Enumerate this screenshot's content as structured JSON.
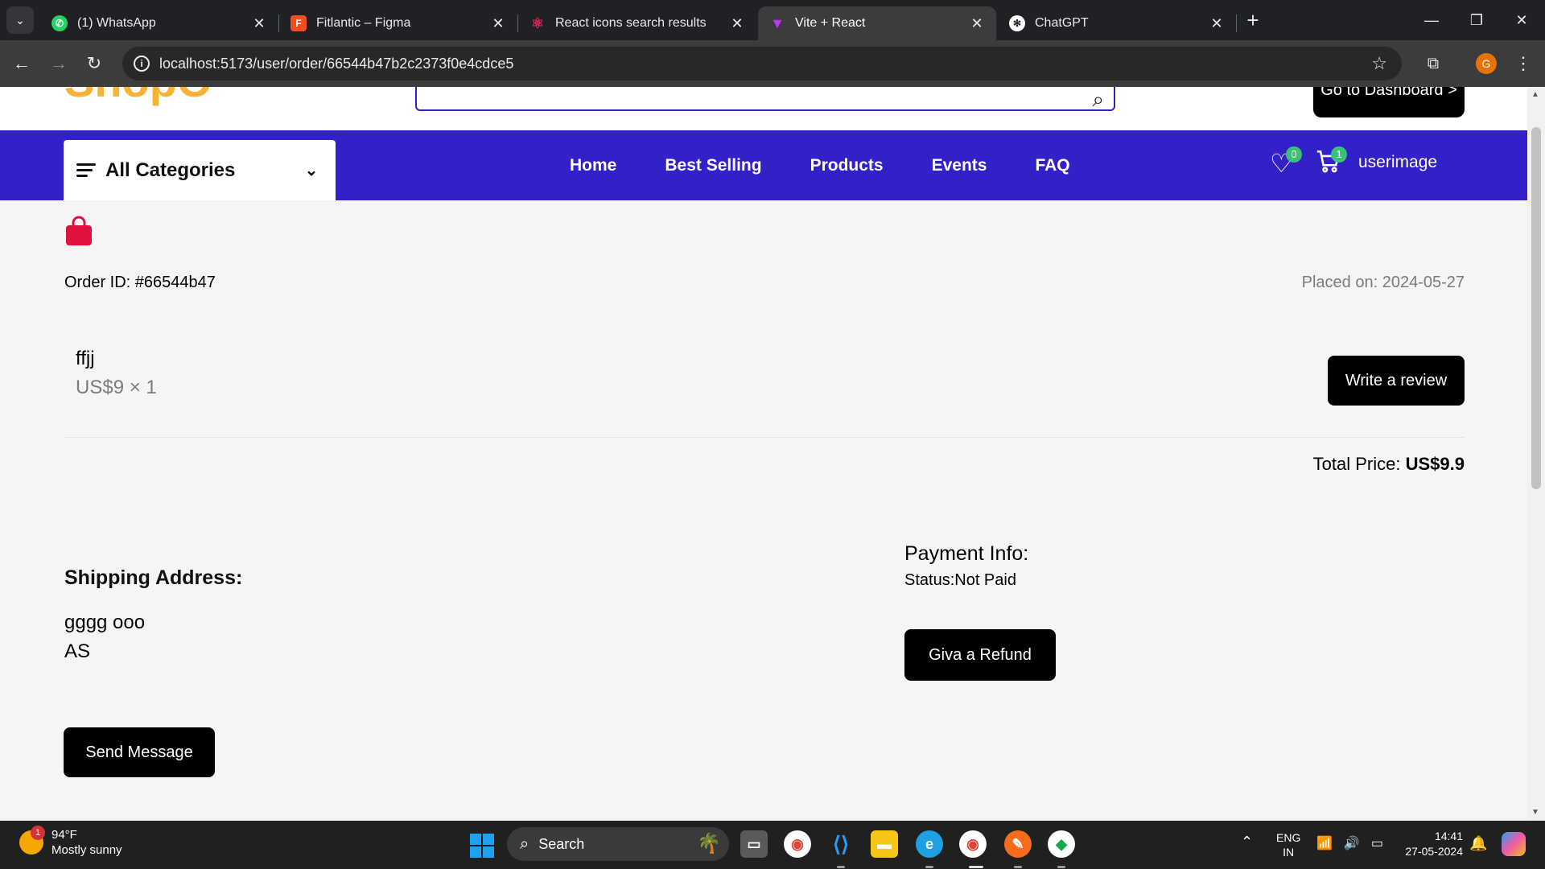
{
  "browser": {
    "tabs": [
      {
        "title": "(1) WhatsApp",
        "icon": "whatsapp-icon",
        "icon_color": "#25d366"
      },
      {
        "title": "Fitlantic – Figma",
        "icon": "figma-icon",
        "icon_color": "#f24e1e"
      },
      {
        "title": "React icons search results",
        "icon": "react-icon",
        "icon_color": "#e0245e"
      },
      {
        "title": "Vite + React",
        "icon": "vite-icon",
        "icon_color": "#bd34fe",
        "active": true
      },
      {
        "title": "ChatGPT",
        "icon": "chatgpt-icon",
        "icon_color": "#ffffff"
      }
    ],
    "url": "localhost:5173/user/order/66544b47b2c2373f0e4cdce5",
    "profile_initial": "G"
  },
  "site": {
    "logo_text": "ShopO",
    "dashboard_button": "Go to Dashboard >",
    "categories_label": "All Categories",
    "nav": [
      "Home",
      "Best Selling",
      "Products",
      "Events",
      "FAQ"
    ],
    "wishlist_count": "0",
    "cart_count": "1",
    "user_image_alt": "userimage",
    "brand_color": "#3321c8"
  },
  "order": {
    "id_text": "Order ID: #66544b47",
    "placed_on": "Placed on: 2024-05-27",
    "item_name": "ffjj",
    "item_price": "US$9 × 1",
    "review_button": "Write a review",
    "total_label": "Total Price:",
    "total_value": "US$9.9",
    "shipping_heading": "Shipping Address:",
    "shipping_lines": [
      "gggg ooo",
      "AS"
    ],
    "payment_heading": "Payment Info:",
    "payment_status": "Status:Not Paid",
    "refund_button": "Giva a Refund",
    "message_button": "Send Message",
    "bag_color": "#e0103f"
  },
  "taskbar": {
    "weather_temp": "94°F",
    "weather_desc": "Mostly sunny",
    "weather_badge": "1",
    "search_label": "Search",
    "lang_top": "ENG",
    "lang_bottom": "IN",
    "time": "14:41",
    "date": "27-05-2024"
  }
}
